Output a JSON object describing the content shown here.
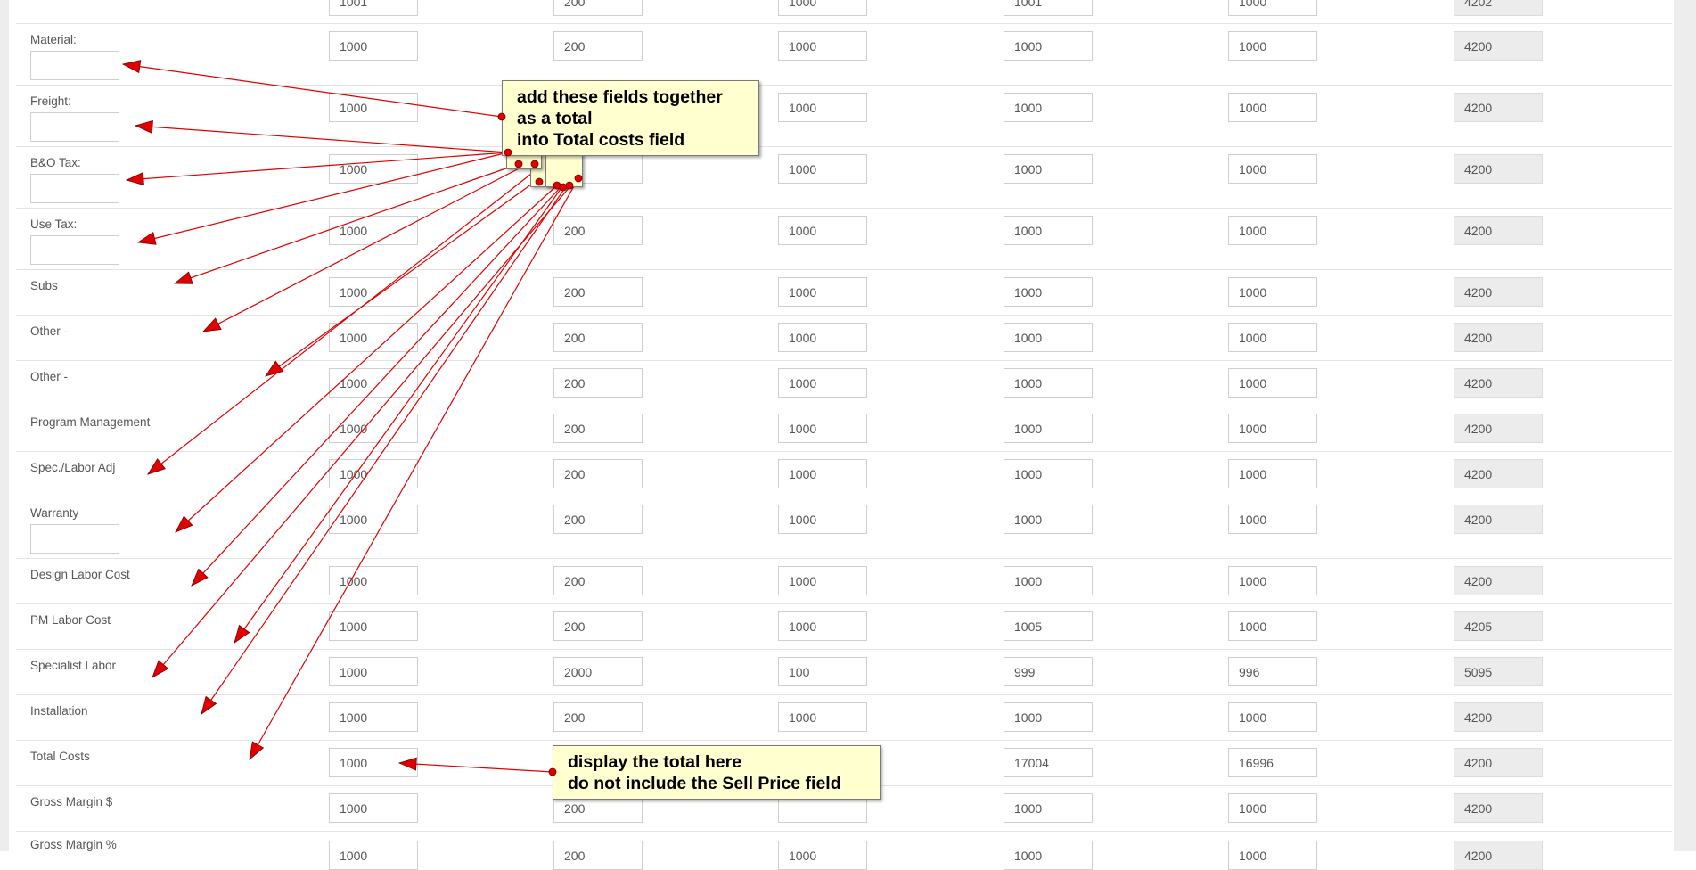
{
  "form": {
    "rows": [
      {
        "label": "",
        "values": [
          "1001",
          "200",
          "1000",
          "1001",
          "1000",
          "4202"
        ]
      },
      {
        "label": "Material:",
        "has_sub_input": true,
        "values": [
          "1000",
          "200",
          "1000",
          "1000",
          "1000",
          "4200"
        ]
      },
      {
        "label": "Freight:",
        "has_sub_input": true,
        "values": [
          "1000",
          "",
          "1000",
          "1000",
          "1000",
          "4200"
        ]
      },
      {
        "label": "B&O Tax:",
        "has_sub_input": true,
        "values": [
          "1000",
          "",
          "1000",
          "1000",
          "1000",
          "4200"
        ]
      },
      {
        "label": "Use Tax:",
        "has_sub_input": true,
        "values": [
          "1000",
          "200",
          "1000",
          "1000",
          "1000",
          "4200"
        ]
      },
      {
        "label": "Subs",
        "values": [
          "1000",
          "200",
          "1000",
          "1000",
          "1000",
          "4200"
        ]
      },
      {
        "label": "Other -",
        "values": [
          "1000",
          "200",
          "1000",
          "1000",
          "1000",
          "4200"
        ]
      },
      {
        "label": "Other -",
        "values": [
          "1000",
          "200",
          "1000",
          "1000",
          "1000",
          "4200"
        ]
      },
      {
        "label": "Program Management",
        "values": [
          "1000",
          "200",
          "1000",
          "1000",
          "1000",
          "4200"
        ]
      },
      {
        "label": "Spec./Labor Adj",
        "values": [
          "1000",
          "200",
          "1000",
          "1000",
          "1000",
          "4200"
        ]
      },
      {
        "label": "Warranty",
        "has_sub_input": true,
        "values": [
          "1000",
          "200",
          "1000",
          "1000",
          "1000",
          "4200"
        ]
      },
      {
        "label": "Design Labor Cost",
        "values": [
          "1000",
          "200",
          "1000",
          "1000",
          "1000",
          "4200"
        ]
      },
      {
        "label": "PM Labor Cost",
        "values": [
          "1000",
          "200",
          "1000",
          "1005",
          "1000",
          "4205"
        ]
      },
      {
        "label": "Specialist Labor",
        "values": [
          "1000",
          "2000",
          "100",
          "999",
          "996",
          "5095"
        ]
      },
      {
        "label": "Installation",
        "values": [
          "1000",
          "200",
          "1000",
          "1000",
          "1000",
          "4200"
        ]
      },
      {
        "label": "Total Costs",
        "values": [
          "1000",
          "",
          "",
          "17004",
          "16996",
          "4200"
        ]
      },
      {
        "label": "Gross Margin $",
        "values": [
          "1000",
          "200",
          "",
          "1000",
          "1000",
          "4200"
        ]
      },
      {
        "label": "Gross Margin %",
        "values": [
          "1000",
          "200",
          "1000",
          "1000",
          "1000",
          "4200"
        ]
      }
    ]
  },
  "annotations": {
    "note1": {
      "lines": [
        "add these fields together",
        "as a total",
        "into Total costs field"
      ]
    },
    "note2": {
      "lines": [
        "display the total here",
        "do not include the Sell Price field"
      ]
    },
    "arrow_color": "#e00000",
    "note_background": "#ffffd0"
  }
}
